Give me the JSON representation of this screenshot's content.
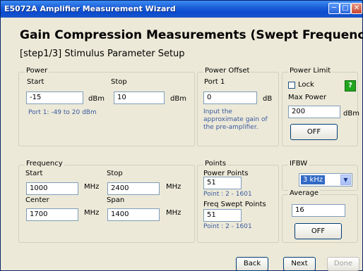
{
  "window": {
    "title": "E5072A Amplifier Measurement Wizard"
  },
  "colors": {
    "titlebar": "#0b4bd0",
    "background": "#ece9d8",
    "hint": "#3a5a9e",
    "help_button": "#21a51e",
    "selection": "#316ac5"
  },
  "icons": {
    "minimize": "minimize-icon",
    "maximize": "maximize-icon",
    "close": "close-icon",
    "help": "help-icon",
    "dropdown": "chevron-down-icon"
  },
  "header": {
    "title": "Gain Compression Measurements (Swept Frequency)",
    "subtitle": "[step1/3] Stimulus Parameter Setup"
  },
  "power": {
    "label": "Power",
    "start_label": "Start",
    "stop_label": "Stop",
    "start_value": "-15",
    "stop_value": "10",
    "unit": "dBm",
    "hint": "Port 1: -49 to 20 dBm"
  },
  "power_offset": {
    "label": "Power Offset",
    "port_label": "Port 1",
    "value": "0",
    "unit": "dB",
    "hint": "Input the approximate gain of the pre-amplifier."
  },
  "power_limit": {
    "label": "Power Limit",
    "lock_label": "Lock",
    "lock_checked": false,
    "help_label": "?",
    "max_label": "Max Power",
    "max_value": "200",
    "unit": "dBm",
    "button_label": "OFF"
  },
  "frequency": {
    "label": "Frequency",
    "start_label": "Start",
    "stop_label": "Stop",
    "center_label": "Center",
    "span_label": "Span",
    "start_value": "1000",
    "stop_value": "2400",
    "center_value": "1700",
    "span_value": "1400",
    "unit": "MHz"
  },
  "points": {
    "label": "Points",
    "power_points_label": "Power Points",
    "power_points_value": "51",
    "power_points_hint": "Point : 2 - 1601",
    "freq_points_label": "Freq Swept Points",
    "freq_points_value": "51",
    "freq_points_hint": "Point : 2 - 1601"
  },
  "ifbw": {
    "label": "IFBW",
    "selected": "3 kHz"
  },
  "average": {
    "label": "Average",
    "value": "16",
    "button_label": "OFF"
  },
  "footer": {
    "back_label": "Back",
    "next_label": "Next",
    "done_label": "Done"
  }
}
